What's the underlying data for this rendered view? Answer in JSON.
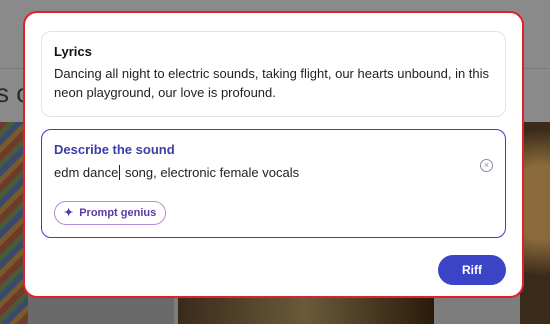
{
  "background": {
    "heading_fragment": "s o"
  },
  "lyrics": {
    "title": "Lyrics",
    "text": "Dancing all night to electric sounds, taking flight, our hearts unbound, in this neon playground, our love is profound."
  },
  "sound": {
    "title": "Describe the sound",
    "value_before_caret": "edm dance",
    "value_after_caret": " song, electronic female vocals",
    "clear_icon": "clear-circle-icon",
    "prompt_genius_label": "Prompt genius",
    "prompt_genius_icon": "sparkle-icon"
  },
  "actions": {
    "riff_label": "Riff"
  },
  "colors": {
    "modal_border": "#e0202c",
    "accent": "#3b44c6",
    "prompt_border": "#b58bd8"
  }
}
